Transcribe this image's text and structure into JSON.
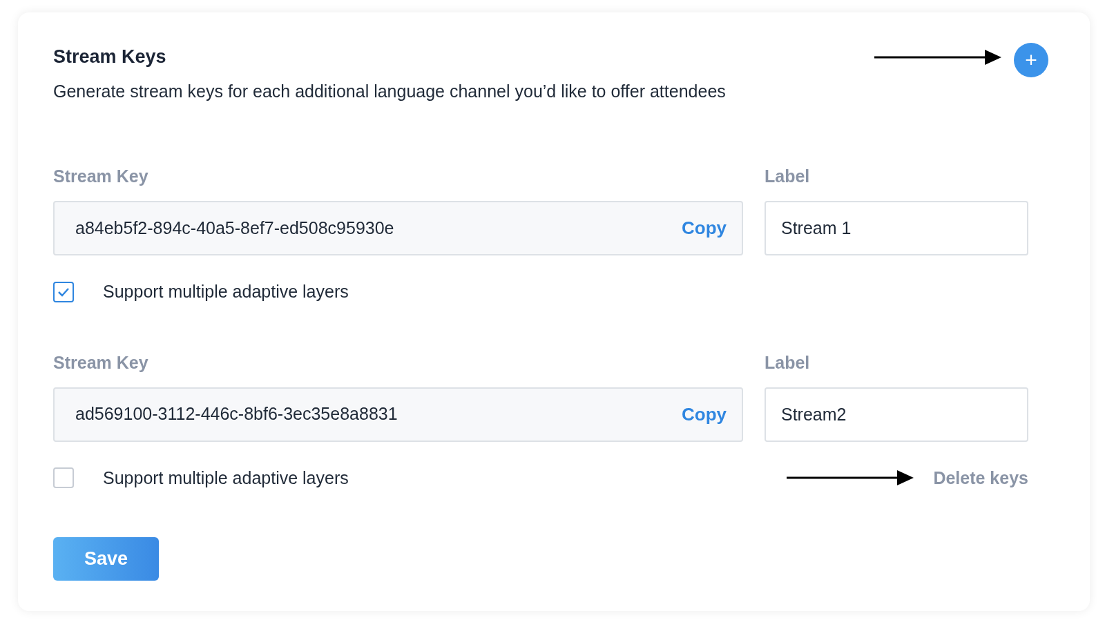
{
  "header": {
    "title": "Stream Keys",
    "description": "Generate stream keys for each additional language channel you’d like to offer attendees",
    "add_button": "+"
  },
  "streams": [
    {
      "key_label": "Stream Key",
      "key": "a84eb5f2-894c-40a5-8ef7-ed508c95930e",
      "copy": "Copy",
      "label_heading": "Label",
      "label": "Stream 1",
      "checkbox_label": "Support multiple adaptive layers",
      "checked": true
    },
    {
      "key_label": "Stream Key",
      "key": "ad569100-3112-446c-8bf6-3ec35e8a8831",
      "copy": "Copy",
      "label_heading": "Label",
      "label": "Stream2",
      "checkbox_label": "Support multiple adaptive layers",
      "checked": false,
      "delete": "Delete keys"
    }
  ],
  "save_button": "Save"
}
